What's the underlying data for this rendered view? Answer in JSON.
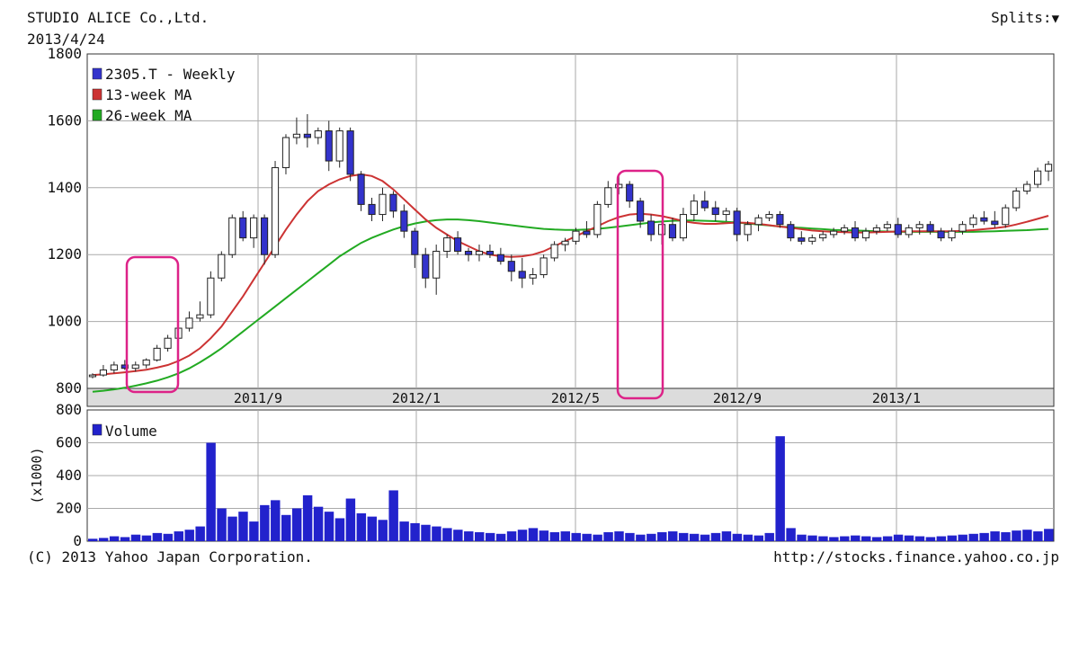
{
  "header": {
    "company": "STUDIO ALICE Co.,Ltd.",
    "date": "2013/4/24",
    "splits_label": "Splits:",
    "splits_icon": "triangle-down-icon"
  },
  "footer": {
    "copyright": "(C) 2013 Yahoo Japan Corporation.",
    "url": "http://stocks.finance.yahoo.co.jp"
  },
  "colors": {
    "candle_up": "#ffffff",
    "candle_down": "#3333cc",
    "ma13": "#cc3333",
    "ma26": "#22aa22",
    "volume": "#2222cc",
    "highlight": "#dd2288"
  },
  "chart_data": [
    {
      "type": "candlestick",
      "legend": [
        "2305.T - Weekly",
        "13-week MA",
        "26-week MA"
      ],
      "ylim": [
        800,
        1800
      ],
      "yticks": [
        800,
        1000,
        1200,
        1400,
        1600,
        1800
      ],
      "xtick_labels": [
        "2011/9",
        "2012/1",
        "2012/5",
        "2012/9",
        "2013/1"
      ],
      "grid": true,
      "candles": [
        [
          835,
          845,
          830,
          840
        ],
        [
          840,
          870,
          835,
          855
        ],
        [
          855,
          880,
          845,
          870
        ],
        [
          870,
          885,
          855,
          860
        ],
        [
          860,
          880,
          850,
          870
        ],
        [
          870,
          890,
          860,
          885
        ],
        [
          885,
          930,
          880,
          920
        ],
        [
          920,
          960,
          910,
          950
        ],
        [
          950,
          990,
          940,
          980
        ],
        [
          980,
          1030,
          970,
          1010
        ],
        [
          1010,
          1060,
          1000,
          1020
        ],
        [
          1020,
          1150,
          1010,
          1130
        ],
        [
          1130,
          1210,
          1120,
          1200
        ],
        [
          1200,
          1320,
          1190,
          1310
        ],
        [
          1310,
          1330,
          1240,
          1250
        ],
        [
          1250,
          1320,
          1220,
          1310
        ],
        [
          1310,
          1320,
          1170,
          1200
        ],
        [
          1200,
          1480,
          1190,
          1460
        ],
        [
          1460,
          1560,
          1440,
          1550
        ],
        [
          1550,
          1610,
          1530,
          1560
        ],
        [
          1560,
          1620,
          1520,
          1550
        ],
        [
          1550,
          1580,
          1530,
          1570
        ],
        [
          1570,
          1600,
          1450,
          1480
        ],
        [
          1480,
          1580,
          1460,
          1570
        ],
        [
          1570,
          1580,
          1420,
          1440
        ],
        [
          1440,
          1450,
          1330,
          1350
        ],
        [
          1350,
          1370,
          1300,
          1320
        ],
        [
          1320,
          1400,
          1300,
          1380
        ],
        [
          1380,
          1390,
          1310,
          1330
        ],
        [
          1330,
          1350,
          1250,
          1270
        ],
        [
          1270,
          1280,
          1160,
          1200
        ],
        [
          1200,
          1220,
          1100,
          1130
        ],
        [
          1130,
          1230,
          1080,
          1210
        ],
        [
          1210,
          1260,
          1190,
          1250
        ],
        [
          1250,
          1270,
          1200,
          1210
        ],
        [
          1210,
          1220,
          1180,
          1200
        ],
        [
          1200,
          1230,
          1180,
          1210
        ],
        [
          1210,
          1230,
          1190,
          1200
        ],
        [
          1200,
          1220,
          1170,
          1180
        ],
        [
          1180,
          1200,
          1120,
          1150
        ],
        [
          1150,
          1190,
          1100,
          1130
        ],
        [
          1130,
          1160,
          1110,
          1140
        ],
        [
          1140,
          1200,
          1130,
          1190
        ],
        [
          1190,
          1240,
          1180,
          1230
        ],
        [
          1230,
          1250,
          1210,
          1240
        ],
        [
          1240,
          1280,
          1230,
          1270
        ],
        [
          1270,
          1300,
          1250,
          1260
        ],
        [
          1260,
          1360,
          1250,
          1350
        ],
        [
          1350,
          1420,
          1340,
          1400
        ],
        [
          1400,
          1440,
          1380,
          1410
        ],
        [
          1410,
          1420,
          1340,
          1360
        ],
        [
          1360,
          1370,
          1280,
          1300
        ],
        [
          1300,
          1320,
          1240,
          1260
        ],
        [
          1260,
          1300,
          1230,
          1290
        ],
        [
          1290,
          1310,
          1240,
          1250
        ],
        [
          1250,
          1340,
          1240,
          1320
        ],
        [
          1320,
          1380,
          1300,
          1360
        ],
        [
          1360,
          1390,
          1330,
          1340
        ],
        [
          1340,
          1360,
          1300,
          1320
        ],
        [
          1320,
          1340,
          1300,
          1330
        ],
        [
          1330,
          1340,
          1240,
          1260
        ],
        [
          1260,
          1300,
          1240,
          1290
        ],
        [
          1290,
          1320,
          1270,
          1310
        ],
        [
          1310,
          1330,
          1300,
          1320
        ],
        [
          1320,
          1330,
          1280,
          1290
        ],
        [
          1290,
          1300,
          1240,
          1250
        ],
        [
          1250,
          1270,
          1230,
          1240
        ],
        [
          1240,
          1260,
          1230,
          1250
        ],
        [
          1250,
          1270,
          1240,
          1260
        ],
        [
          1260,
          1280,
          1250,
          1270
        ],
        [
          1270,
          1290,
          1260,
          1280
        ],
        [
          1280,
          1300,
          1240,
          1250
        ],
        [
          1250,
          1280,
          1240,
          1270
        ],
        [
          1270,
          1290,
          1260,
          1280
        ],
        [
          1280,
          1300,
          1270,
          1290
        ],
        [
          1290,
          1310,
          1250,
          1260
        ],
        [
          1260,
          1290,
          1250,
          1280
        ],
        [
          1280,
          1300,
          1260,
          1290
        ],
        [
          1290,
          1300,
          1260,
          1270
        ],
        [
          1270,
          1280,
          1240,
          1250
        ],
        [
          1250,
          1280,
          1240,
          1270
        ],
        [
          1270,
          1300,
          1260,
          1290
        ],
        [
          1290,
          1320,
          1280,
          1310
        ],
        [
          1310,
          1330,
          1290,
          1300
        ],
        [
          1300,
          1330,
          1280,
          1290
        ],
        [
          1290,
          1350,
          1280,
          1340
        ],
        [
          1340,
          1400,
          1330,
          1390
        ],
        [
          1390,
          1420,
          1380,
          1410
        ],
        [
          1410,
          1460,
          1400,
          1450
        ],
        [
          1450,
          1480,
          1420,
          1470
        ]
      ],
      "ma13": [
        840,
        842,
        845,
        848,
        852,
        856,
        862,
        870,
        882,
        898,
        920,
        950,
        985,
        1030,
        1075,
        1125,
        1175,
        1225,
        1275,
        1320,
        1360,
        1390,
        1410,
        1425,
        1435,
        1440,
        1435,
        1420,
        1395,
        1365,
        1335,
        1305,
        1280,
        1260,
        1240,
        1225,
        1210,
        1200,
        1195,
        1193,
        1195,
        1200,
        1210,
        1225,
        1240,
        1255,
        1270,
        1285,
        1300,
        1312,
        1320,
        1322,
        1320,
        1315,
        1308,
        1300,
        1295,
        1292,
        1292,
        1294,
        1296,
        1295,
        1292,
        1288,
        1284,
        1280,
        1276,
        1272,
        1270,
        1268,
        1267,
        1266,
        1266,
        1267,
        1268,
        1269,
        1270,
        1270,
        1270,
        1270,
        1270,
        1271,
        1273,
        1276,
        1279,
        1283,
        1290,
        1298,
        1307,
        1316
      ],
      "ma26": [
        790,
        793,
        797,
        802,
        808,
        815,
        823,
        833,
        845,
        860,
        878,
        898,
        920,
        945,
        970,
        995,
        1020,
        1045,
        1070,
        1095,
        1120,
        1145,
        1170,
        1195,
        1215,
        1235,
        1250,
        1263,
        1275,
        1285,
        1293,
        1299,
        1303,
        1305,
        1305,
        1303,
        1300,
        1296,
        1292,
        1288,
        1284,
        1280,
        1277,
        1275,
        1274,
        1274,
        1275,
        1277,
        1280,
        1284,
        1288,
        1292,
        1296,
        1299,
        1301,
        1302,
        1302,
        1301,
        1300,
        1298,
        1296,
        1293,
        1290,
        1287,
        1284,
        1282,
        1280,
        1278,
        1276,
        1274,
        1273,
        1272,
        1271,
        1270,
        1269,
        1268,
        1268,
        1268,
        1268,
        1268,
        1268,
        1268,
        1268,
        1269,
        1270,
        1271,
        1272,
        1273,
        1275,
        1277
      ]
    },
    {
      "type": "bar",
      "legend": [
        "Volume"
      ],
      "ylabel": "(x1000)",
      "ylim": [
        0,
        800
      ],
      "yticks": [
        0,
        200,
        400,
        600,
        800
      ],
      "grid": true,
      "values": [
        15,
        20,
        30,
        25,
        40,
        35,
        50,
        45,
        60,
        70,
        90,
        600,
        200,
        150,
        180,
        120,
        220,
        250,
        160,
        200,
        280,
        210,
        180,
        140,
        260,
        170,
        150,
        130,
        310,
        120,
        110,
        100,
        90,
        80,
        70,
        60,
        55,
        50,
        45,
        60,
        70,
        80,
        65,
        55,
        60,
        50,
        45,
        40,
        55,
        60,
        50,
        40,
        45,
        55,
        60,
        50,
        45,
        40,
        50,
        60,
        45,
        40,
        35,
        50,
        640,
        80,
        40,
        35,
        30,
        25,
        30,
        35,
        30,
        25,
        30,
        40,
        35,
        30,
        25,
        30,
        35,
        40,
        45,
        50,
        60,
        55,
        65,
        70,
        60,
        75
      ]
    }
  ]
}
